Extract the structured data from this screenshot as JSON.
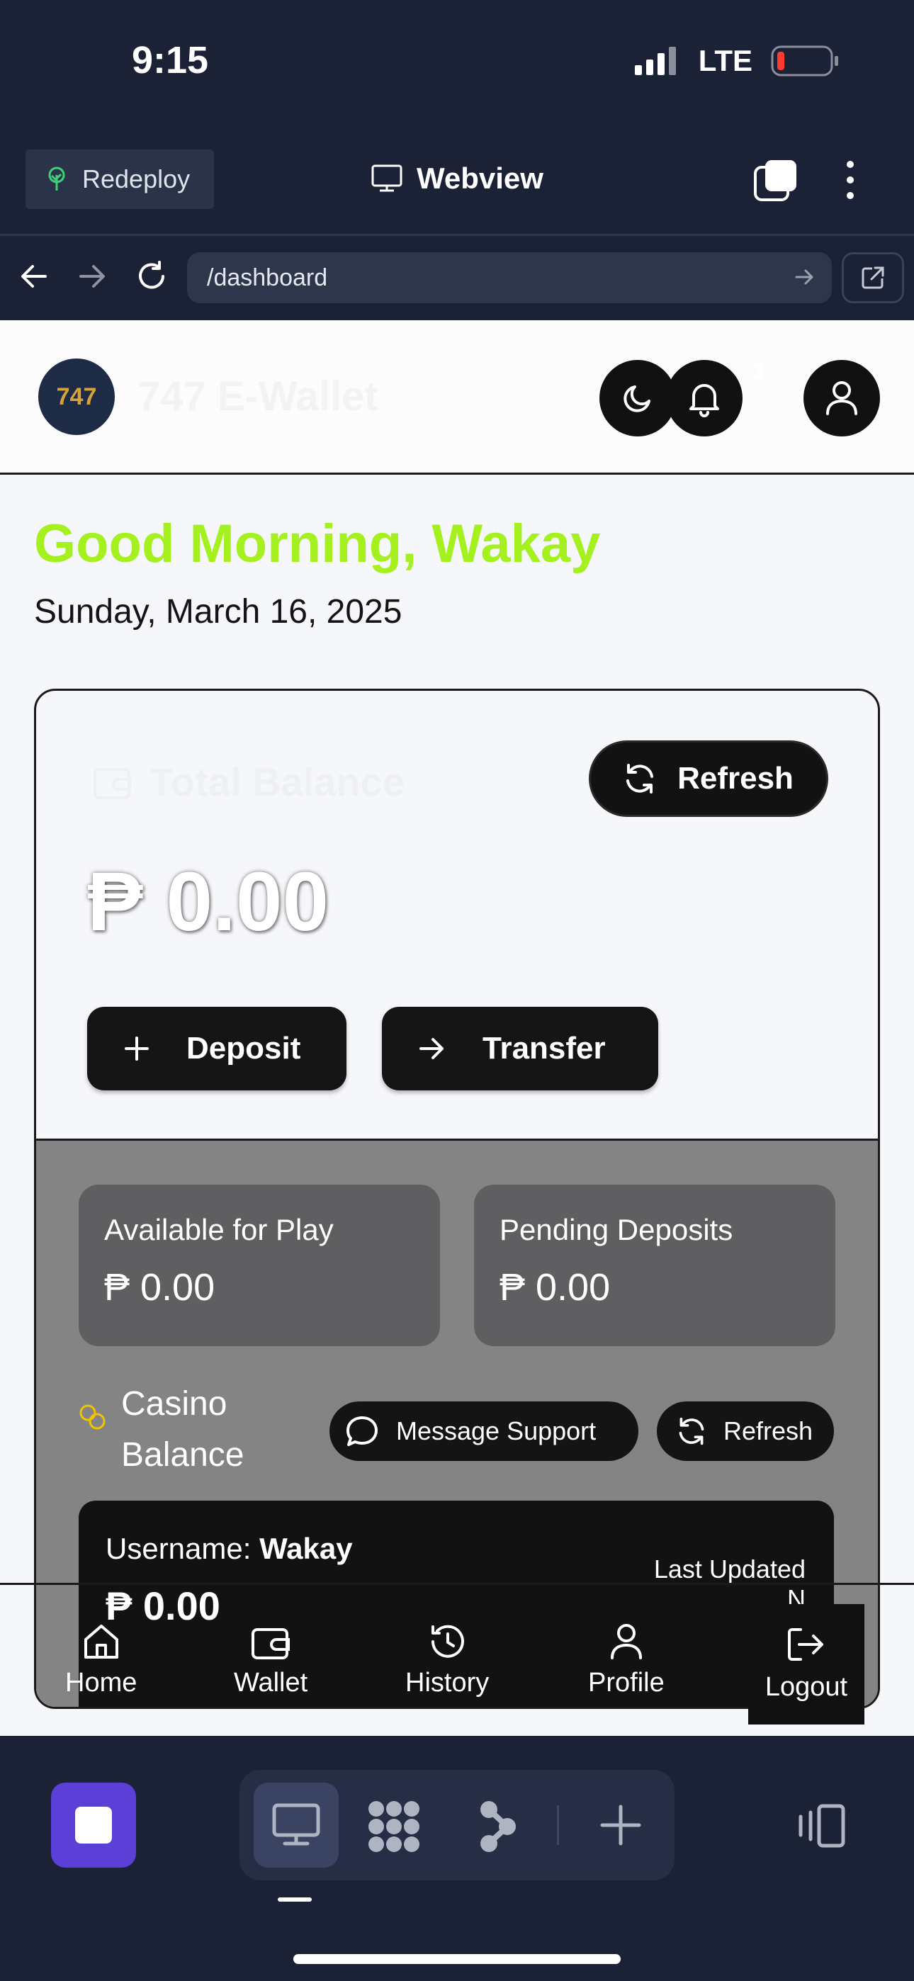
{
  "status_bar": {
    "time": "9:15",
    "network": "LTE"
  },
  "browser": {
    "redeploy_label": "Redeploy",
    "view_title": "Webview",
    "url": "/dashboard"
  },
  "site": {
    "logo_text": "747",
    "name": "747 E-Wallet",
    "notification_count": "3",
    "greeting": "Good Morning, Wakay",
    "date": "Sunday, March 16, 2025"
  },
  "balance": {
    "label": "Total Balance",
    "refresh_label": "Refresh",
    "amount": "₱ 0.00",
    "deposit_label": "Deposit",
    "transfer_label": "Transfer"
  },
  "stats": [
    {
      "label": "Available for Play",
      "value": "₱ 0.00"
    },
    {
      "label": "Pending Deposits",
      "value": "₱ 0.00"
    }
  ],
  "casino": {
    "label": "Casino Balance",
    "message_support_label": "Message Support",
    "refresh_label": "Refresh",
    "username_prefix": "Username:",
    "username": "Wakay",
    "amount": "₱ 0.00",
    "last_updated_label": "Last Updated",
    "last_updated_value": "N"
  },
  "bottom_nav": {
    "home": "Home",
    "wallet": "Wallet",
    "history": "History",
    "profile": "Profile",
    "logout": "Logout"
  },
  "colors": {
    "app_background": "#1b2236",
    "greeting": "#a5f01f",
    "stop_button": "#5b3fd6",
    "logo_text": "#d6a23a"
  }
}
